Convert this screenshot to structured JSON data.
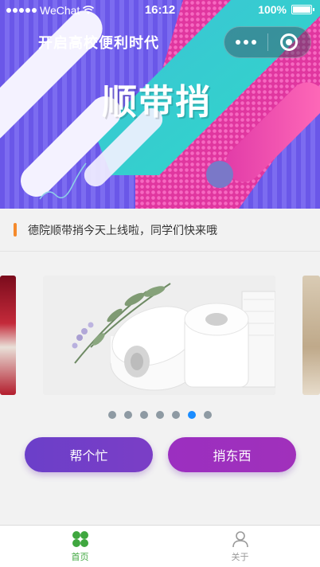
{
  "status_bar": {
    "carrier": "WeChat",
    "time": "16:12",
    "battery": "100%"
  },
  "banner": {
    "subtitle": "开启高校便利时代",
    "headline": "顺带捎"
  },
  "notice": {
    "text": "德院顺带捎今天上线啦，同学们快来哦"
  },
  "carousel": {
    "total_slides": 7,
    "active_index": 5
  },
  "actions": {
    "help_label": "帮个忙",
    "send_label": "捎东西"
  },
  "tabbar": {
    "items": [
      {
        "label": "首页",
        "icon": "grid-icon",
        "active": true
      },
      {
        "label": "关于",
        "icon": "person-icon",
        "active": false
      }
    ]
  },
  "colors": {
    "accent_green": "#3fa73f",
    "active_dot": "#1a8cff",
    "notice_bar": "#f58a2c",
    "button_left": "#6b3fc9",
    "button_right": "#a030bb"
  }
}
